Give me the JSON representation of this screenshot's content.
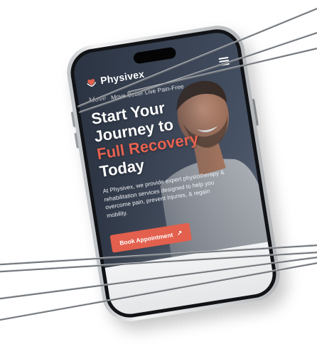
{
  "nav": {
    "brand": "Physivex",
    "logo_icon": "heart-hands-icon",
    "menu_icon": "hamburger-menu-icon"
  },
  "hero": {
    "script_text": "Move",
    "tagline": "Move Better Live Pain-Free",
    "headline_1": "Start Your",
    "headline_2": "Journey to",
    "headline_accent": "Full Recovery",
    "headline_3": "Today",
    "description": "At Physivex, we provide expert physiotherapy & rehabilitation services designed to help you overcome pain, prevent injuries, & regain mobility.",
    "cta_label": "Book Appointment",
    "cta_icon": "arrow-up-right-icon"
  },
  "colors": {
    "accent": "#e2604d",
    "headline_accent": "#e86250",
    "screen_bg": "#4a5567",
    "text": "#ffffff"
  }
}
